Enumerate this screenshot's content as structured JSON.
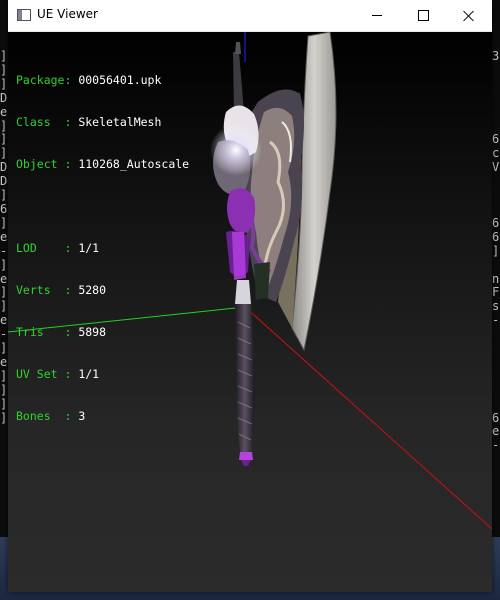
{
  "window": {
    "title": "UE Viewer"
  },
  "info": {
    "package": {
      "label": "Package: ",
      "value": "00056401.upk"
    },
    "class": {
      "label": "Class  : ",
      "value": "SkeletalMesh"
    },
    "object": {
      "label": "Object : ",
      "value": "110268_Autoscale"
    },
    "lod": {
      "label": "LOD    : ",
      "value": "1/1"
    },
    "verts": {
      "label": "Verts  : ",
      "value": "5280"
    },
    "tris": {
      "label": "Tris   : ",
      "value": "5898"
    },
    "uvset": {
      "label": "UV Set : ",
      "value": "1/1"
    },
    "bones": {
      "label": "Bones  : ",
      "value": "3"
    }
  },
  "background_console": {
    "left_column": "]\n]\n]\nD\ne\n]\n]\n]\nD\nD\n]\n6\n]\ne\n-\n]\ne\n]\n]\ne\n-\n]\ne\n]\n]\n]\n]",
    "right_column": "3\n\n\n\n\n\n6\nc\nV\n\n\n\n6\n6\n]\n\nn\nF\ns\n-\n\n\n\n\n\n\n6\ne\n-"
  },
  "colors": {
    "info_label": "#31d12f",
    "info_value": "#ffffff",
    "axis_x": "#d01010",
    "axis_y": "#22d022",
    "axis_z": "#2020e0"
  },
  "viewport": {
    "object_icon": "battle-axe"
  }
}
